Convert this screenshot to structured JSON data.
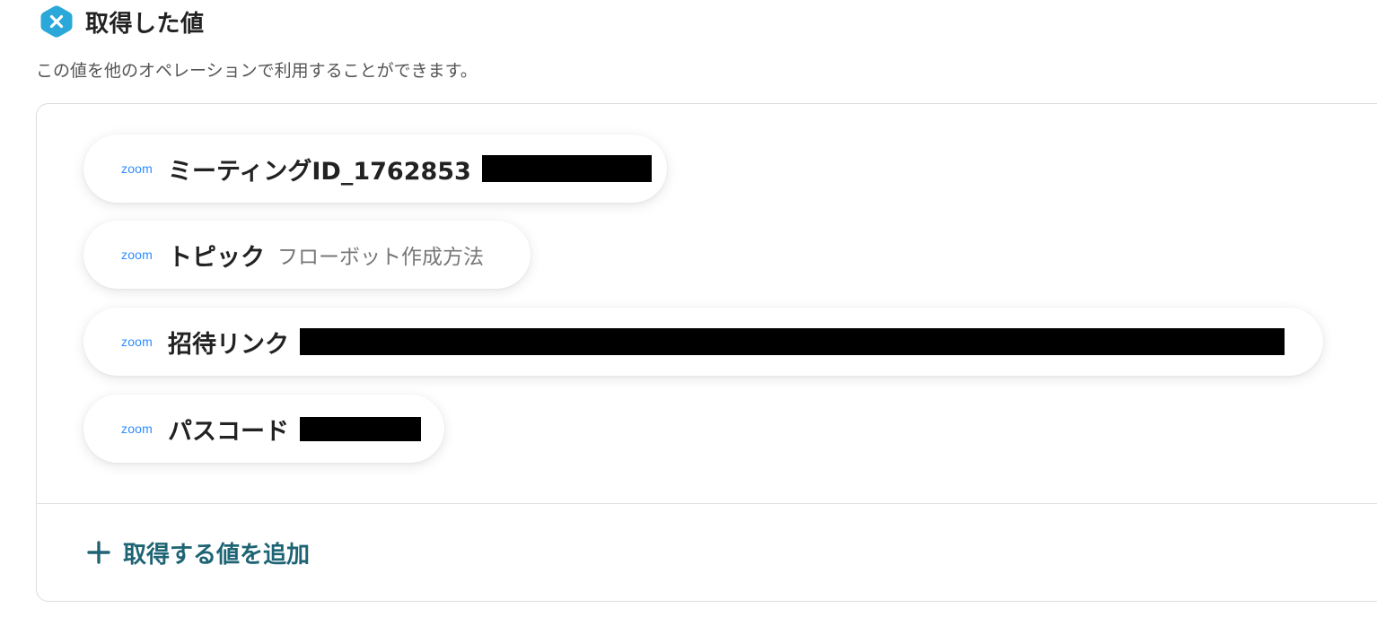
{
  "section": {
    "title": "取得した値",
    "description": "この値を他のオペレーションで利用することができます。",
    "icon": "hexagon-x-icon",
    "accent_color": "#2aa8d9"
  },
  "outputs": [
    {
      "source": "zoom",
      "label": "ミーティングID_1762853",
      "value": "",
      "redacted": true
    },
    {
      "source": "zoom",
      "label": "トピック",
      "value": "フローボット作成方法",
      "redacted": false
    },
    {
      "source": "zoom",
      "label": "招待リンク",
      "value": "",
      "redacted": true
    },
    {
      "source": "zoom",
      "label": "パスコード",
      "value": "",
      "redacted": true
    }
  ],
  "add_button": {
    "label": "取得する値を追加",
    "icon": "plus-icon",
    "color": "#1e6474"
  },
  "colors": {
    "zoom_brand": "#2d8cff",
    "redaction": "#000000"
  }
}
